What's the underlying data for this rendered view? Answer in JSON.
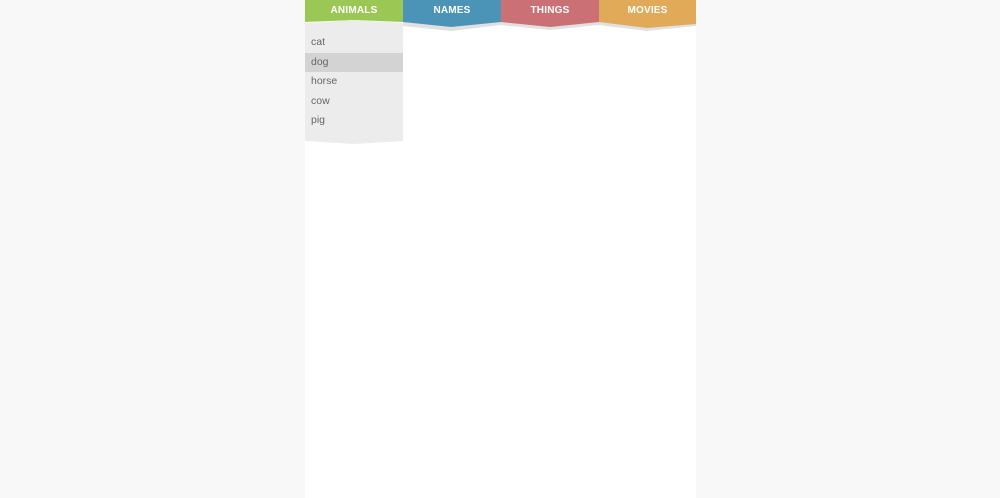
{
  "tabs": [
    {
      "label": "ANIMALS",
      "color": "#9bc854",
      "active": true
    },
    {
      "label": "NAMES",
      "color": "#4b94b8"
    },
    {
      "label": "THINGS",
      "color": "#cb7175"
    },
    {
      "label": "MOVIES",
      "color": "#e0aa58"
    }
  ],
  "dropdown": {
    "background": "#ececec",
    "hover_color": "#d3d3d3",
    "items": [
      "cat",
      "dog",
      "horse",
      "cow",
      "pig"
    ],
    "hovered_item": "dog"
  }
}
